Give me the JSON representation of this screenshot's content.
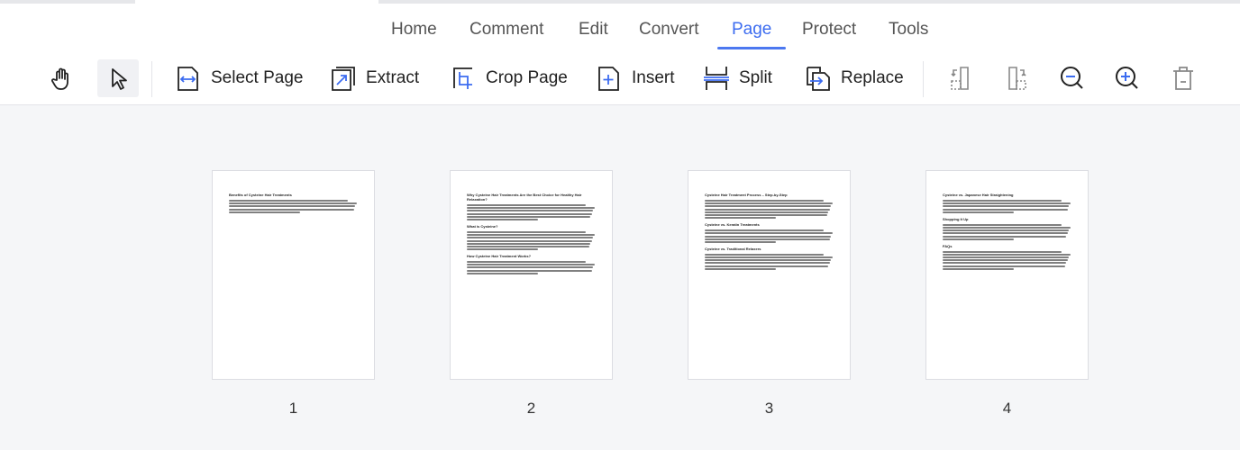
{
  "tabs": [
    {
      "label": "Home"
    },
    {
      "label": "Comment"
    },
    {
      "label": "Edit"
    },
    {
      "label": "Convert"
    },
    {
      "label": "Page",
      "active": true
    },
    {
      "label": "Protect"
    },
    {
      "label": "Tools"
    }
  ],
  "toolbar": {
    "select_page": "Select Page",
    "extract": "Extract",
    "crop_page": "Crop Page",
    "insert": "Insert",
    "split": "Split",
    "replace": "Replace"
  },
  "accent": "#4c78f0",
  "pages": [
    {
      "number": "1",
      "headings": [
        "Benefits of Cysteine Hair Treatments"
      ]
    },
    {
      "number": "2",
      "headings": [
        "Why Cysteine Hair Treatments Are the Best Choice for Healthy Hair Relaxation?",
        "What is Cysteine?",
        "How Cysteine Hair Treatment Works?"
      ]
    },
    {
      "number": "3",
      "headings": [
        "Cysteine Hair Treatment Process – Step-by-Step",
        "Cysteine vs. Keratin Treatments",
        "Cysteine vs. Traditional Relaxers"
      ]
    },
    {
      "number": "4",
      "headings": [
        "Cysteine vs. Japanese Hair Straightening",
        "Shopping It Up",
        "FAQs"
      ]
    }
  ]
}
